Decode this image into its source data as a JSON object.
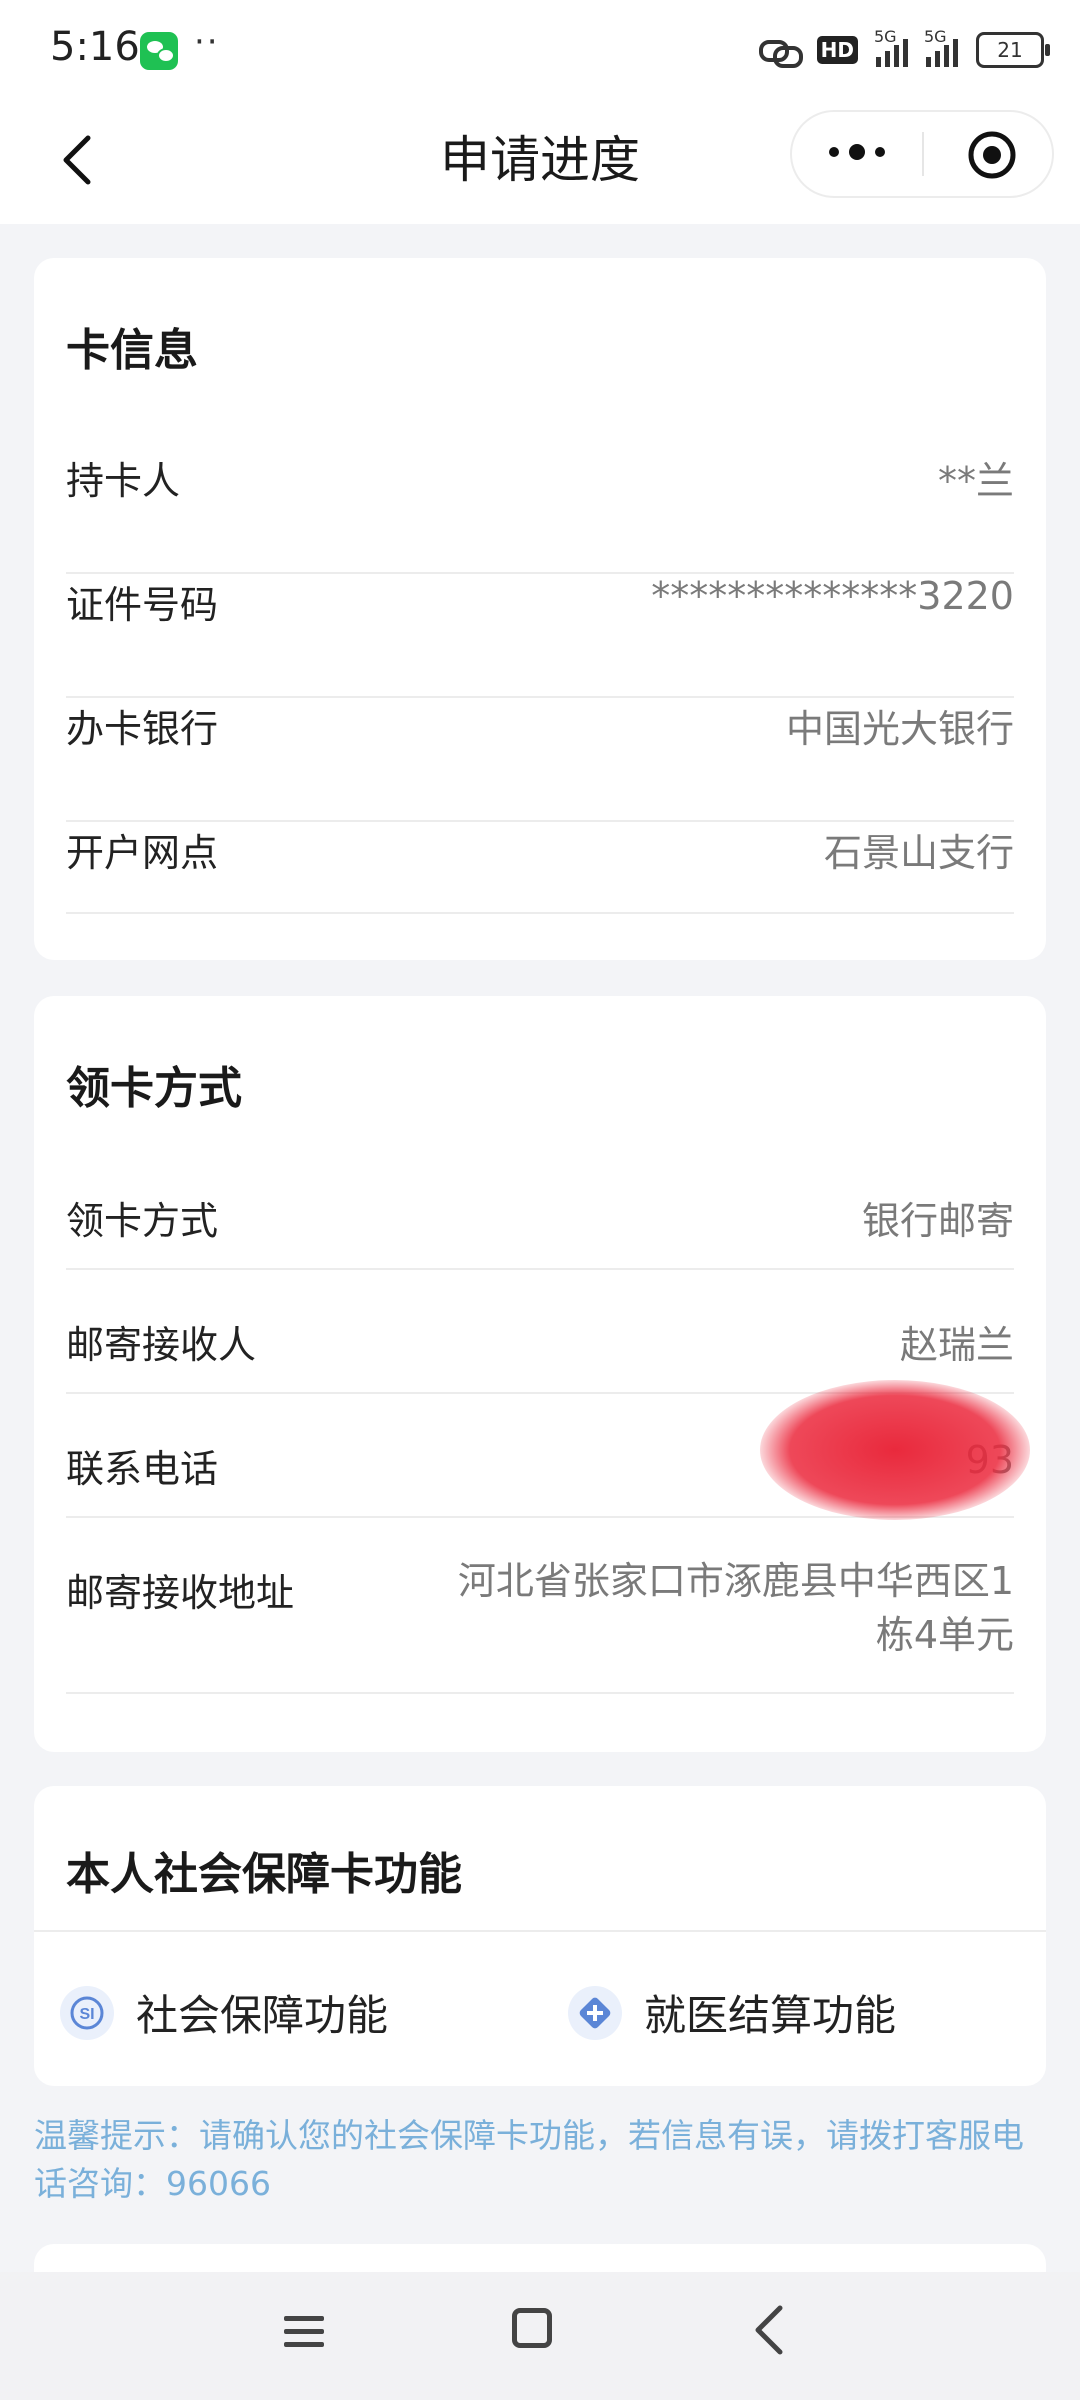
{
  "status_bar": {
    "time": "5:16",
    "battery": "21",
    "network": "5G",
    "hd_label": "HD"
  },
  "nav": {
    "title": "申请进度"
  },
  "card_info": {
    "title": "卡信息",
    "rows": [
      {
        "label": "持卡人",
        "value": "**兰"
      },
      {
        "label": "证件号码",
        "value": "**************3220"
      },
      {
        "label": "办卡银行",
        "value": "中国光大银行"
      },
      {
        "label": "开户网点",
        "value": "石景山支行"
      }
    ]
  },
  "pickup": {
    "title": "领卡方式",
    "rows": [
      {
        "label": "领卡方式",
        "value": "银行邮寄"
      },
      {
        "label": "邮寄接收人",
        "value": "赵瑞兰"
      },
      {
        "label": "联系电话",
        "value": "93"
      },
      {
        "label": "邮寄接收地址",
        "value_line1": "河北省张家口市涿鹿县中华西区1",
        "value_line2": "栋4单元"
      }
    ]
  },
  "functions": {
    "title": "本人社会保障卡功能",
    "items": [
      {
        "label": "社会保障功能",
        "icon": "social-security-icon"
      },
      {
        "label": "就医结算功能",
        "icon": "medical-settlement-icon"
      }
    ]
  },
  "tip": {
    "text": "温馨提示：请确认您的社会保障卡功能，若信息有误，请拨打客服电话咨询：96066"
  },
  "colors": {
    "tip": "#7ab0da",
    "background": "#f3f4f7"
  }
}
